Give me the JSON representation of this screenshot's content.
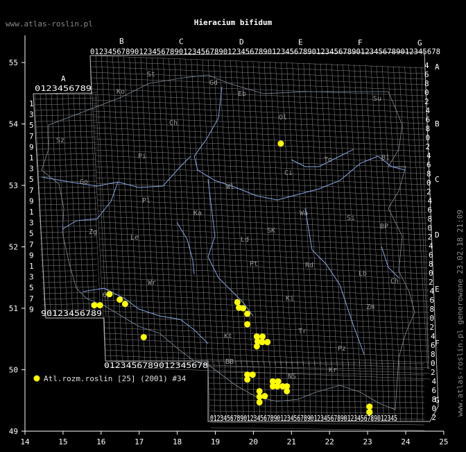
{
  "site": "www.atlas-roslin.pl",
  "title": "Hieracium bifidum",
  "generated": "www.atlas-roslin.pl generowane 23.02.18 21:09",
  "legend": {
    "label": "Atl.rozm.roslin [25] (2001) #34",
    "color": "#ffff00"
  },
  "axes": {
    "lon_ticks": [
      "14",
      "15",
      "16",
      "17",
      "18",
      "19",
      "20",
      "21",
      "22",
      "23",
      "24",
      "25"
    ],
    "lat_ticks": [
      "55",
      "54",
      "53",
      "52",
      "51",
      "50",
      "49"
    ]
  },
  "grid_labels": {
    "top_letters": [
      "B",
      "C",
      "D",
      "E",
      "F",
      "G"
    ],
    "a_letter": "A",
    "right_letters": [
      "A",
      "B",
      "C",
      "D",
      "E",
      "F",
      "G"
    ],
    "top_row": "0123456789012345678901234567890123456789012345678901234567890123456789012345678",
    "a_row": "0123456789",
    "bottom_row": "0123456789",
    "bottom2_row": "01234567890123456789012345678901234567890123456789012345",
    "left_col": [
      "1",
      "3",
      "5",
      "7",
      "9",
      "1",
      "3",
      "5",
      "7",
      "9",
      "1",
      "3",
      "5",
      "7",
      "9",
      "1",
      "3",
      "5",
      "7",
      "9"
    ],
    "right_col": [
      "4",
      "6",
      "8",
      "0",
      "2",
      "4",
      "6",
      "8",
      "0",
      "2",
      "4",
      "6",
      "8",
      "0",
      "2",
      "4",
      "6",
      "8",
      "0",
      "2",
      "4",
      "6",
      "8",
      "0",
      "2",
      "4",
      "6",
      "8",
      "0",
      "2",
      "4",
      "6",
      "8",
      "0",
      "2",
      "4",
      "6",
      "8",
      "0",
      "2"
    ]
  },
  "regions": [
    "St",
    "Ko",
    "Gd",
    "Eb",
    "Su",
    "Ch",
    "Ol",
    "Pi",
    "Bi",
    "Sz",
    "Ci",
    "To",
    "Wl",
    "Ka",
    "Go",
    "Pl",
    "Wa",
    "Si",
    "BP",
    "Zg",
    "Le",
    "Ld",
    "SK",
    "Pt",
    "Rd",
    "Lb",
    "Wr",
    "Op",
    "Kt",
    "Ki",
    "Tr",
    "Ch",
    "Zm",
    "Pz",
    "BB",
    "NS",
    "Kr"
  ],
  "points": [
    {
      "lon": 20.72,
      "lat": 53.68
    },
    {
      "lon": 15.82,
      "lat": 51.05
    },
    {
      "lon": 15.97,
      "lat": 51.05
    },
    {
      "lon": 16.22,
      "lat": 51.23
    },
    {
      "lon": 16.49,
      "lat": 51.14
    },
    {
      "lon": 16.63,
      "lat": 51.07
    },
    {
      "lon": 17.12,
      "lat": 50.53
    },
    {
      "lon": 19.58,
      "lat": 51.1
    },
    {
      "lon": 19.62,
      "lat": 51.01
    },
    {
      "lon": 19.73,
      "lat": 51.0
    },
    {
      "lon": 19.84,
      "lat": 50.91
    },
    {
      "lon": 19.84,
      "lat": 50.74
    },
    {
      "lon": 20.09,
      "lat": 50.54
    },
    {
      "lon": 20.24,
      "lat": 50.54
    },
    {
      "lon": 20.11,
      "lat": 50.46
    },
    {
      "lon": 20.23,
      "lat": 50.45
    },
    {
      "lon": 20.37,
      "lat": 50.45
    },
    {
      "lon": 20.09,
      "lat": 50.38
    },
    {
      "lon": 19.84,
      "lat": 49.92
    },
    {
      "lon": 19.98,
      "lat": 49.92
    },
    {
      "lon": 19.84,
      "lat": 49.84
    },
    {
      "lon": 20.51,
      "lat": 49.81
    },
    {
      "lon": 20.65,
      "lat": 49.81
    },
    {
      "lon": 20.51,
      "lat": 49.73
    },
    {
      "lon": 20.63,
      "lat": 49.73
    },
    {
      "lon": 20.77,
      "lat": 49.73
    },
    {
      "lon": 20.88,
      "lat": 49.73
    },
    {
      "lon": 20.88,
      "lat": 49.65
    },
    {
      "lon": 20.16,
      "lat": 49.65
    },
    {
      "lon": 20.16,
      "lat": 49.56
    },
    {
      "lon": 20.3,
      "lat": 49.57
    },
    {
      "lon": 20.16,
      "lat": 49.47
    },
    {
      "lon": 23.05,
      "lat": 49.4
    },
    {
      "lon": 23.05,
      "lat": 49.31
    }
  ]
}
